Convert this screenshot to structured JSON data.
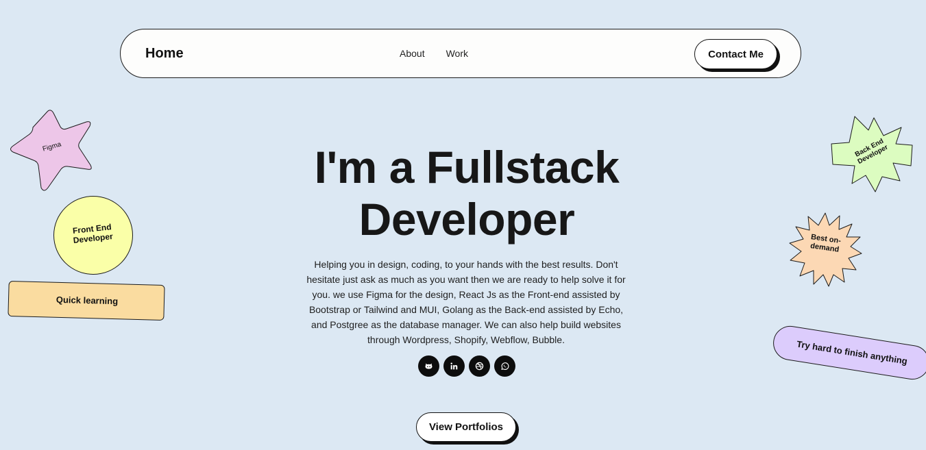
{
  "navbar": {
    "home_label": "Home",
    "links": [
      "About",
      "Work"
    ],
    "contact_label": "Contact Me"
  },
  "hero": {
    "title_line1": "I'm a Fullstack",
    "title_line2": "Developer",
    "description": "Helping you in design, coding, to your hands with the best results. Don't hesitate just ask as much as you want then we are ready to help solve it for you. we use Figma for the design, React Js as the Front-end assisted by Bootstrap or Tailwind and MUI, Golang as the Back-end assisted by Echo, and Postgree as the database manager. We can also help build websites through Wordpress, Shopify, Webflow, Bubble.",
    "portfolio_label": "View Portfolios"
  },
  "socials": [
    {
      "name": "github",
      "icon": "github-icon"
    },
    {
      "name": "linkedin",
      "icon": "linkedin-icon"
    },
    {
      "name": "dribbble",
      "icon": "dribbble-icon"
    },
    {
      "name": "whatsapp",
      "icon": "whatsapp-icon"
    }
  ],
  "stickers": {
    "figma": "Figma",
    "front_end": "Front End Developer",
    "quick_learning": "Quick learning",
    "back_end": "Back End Developer",
    "best_on_demand": "Best on-demand",
    "try_hard": "Try hard to finish anything"
  },
  "colors": {
    "background": "#dce8f3",
    "figma_star": "#edc6e8",
    "front_end_circle": "#faffa8",
    "quick_learning_rect": "#fadca0",
    "back_end_cross": "#dcfcc0",
    "best_burst": "#fcd8b4",
    "try_hard_pill": "#dcccfc"
  }
}
